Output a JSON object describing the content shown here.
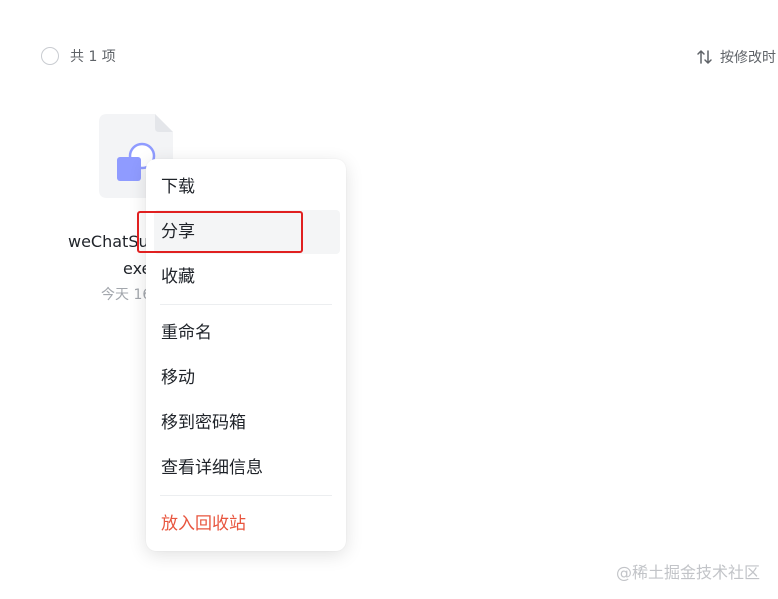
{
  "header": {
    "count_label": "共 1 项",
    "sort_label": "按修改时"
  },
  "file": {
    "icon": "exe-file-icon",
    "name_line1": "weChatSu",
    "name_line2": "exe",
    "date": "今天 16"
  },
  "context_menu": {
    "items": [
      {
        "label": "下载"
      },
      {
        "label": "分享"
      },
      {
        "label": "收藏"
      },
      {
        "label": "重命名"
      },
      {
        "label": "移动"
      },
      {
        "label": "移到密码箱"
      },
      {
        "label": "查看详细信息"
      },
      {
        "label": "放入回收站"
      }
    ]
  },
  "colors": {
    "danger": "#e8553e",
    "highlight_border": "#e02020",
    "icon_blue": "#8f9bff"
  },
  "watermark": "@稀土掘金技术社区"
}
